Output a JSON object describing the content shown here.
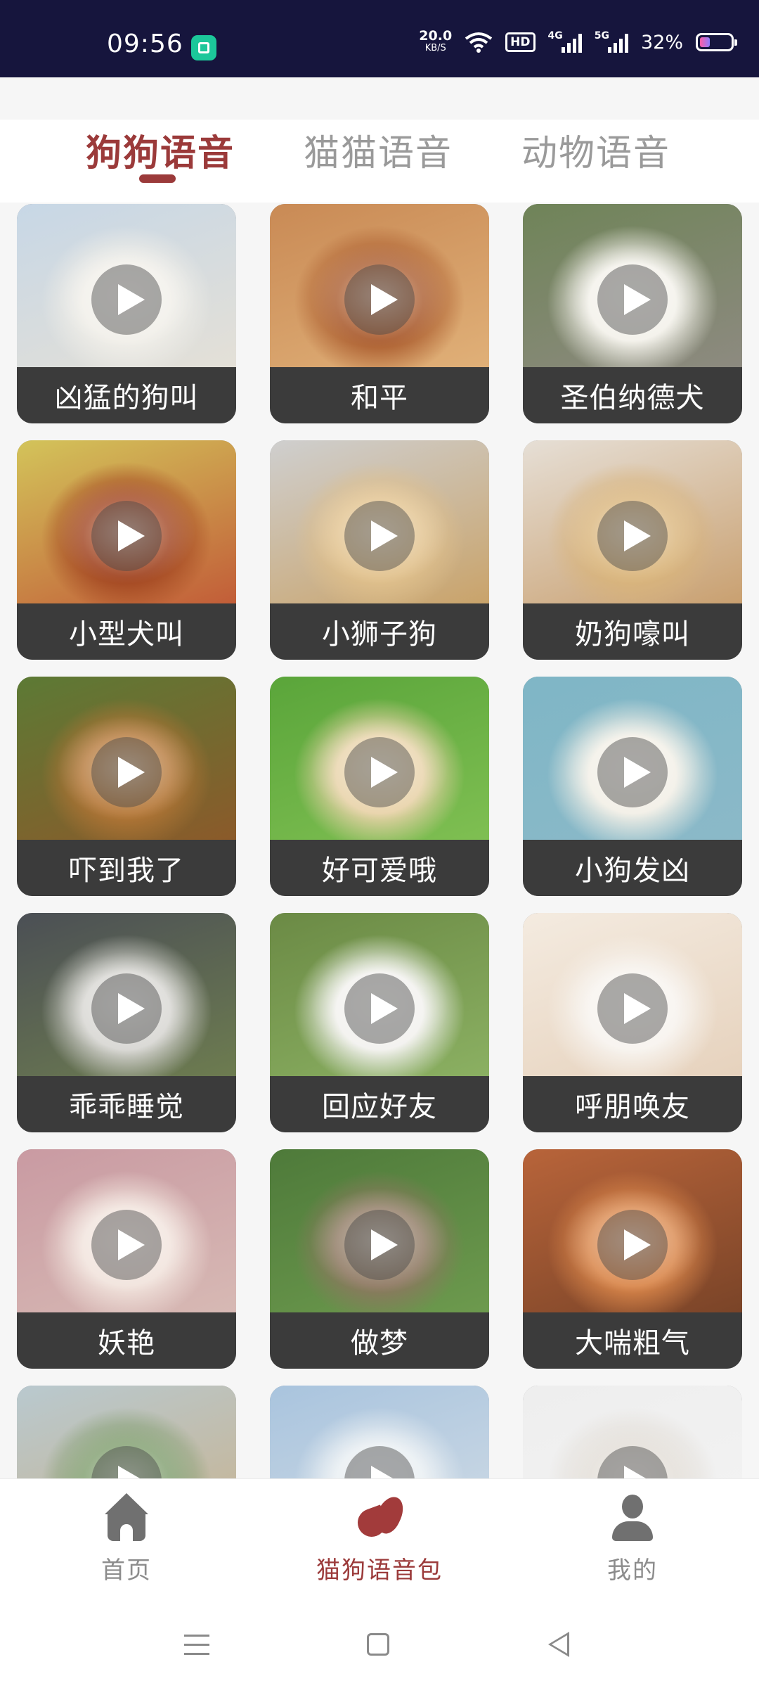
{
  "status_bar": {
    "time": "09:56",
    "net_speed": "20.0",
    "net_speed_unit": "KB/S",
    "hd_label": "HD",
    "network_1": "4G",
    "network_2": "5G",
    "battery": "32%",
    "battery_level": 0.32
  },
  "tabs": [
    {
      "label": "狗狗语音",
      "active": true
    },
    {
      "label": "猫猫语音",
      "active": false
    },
    {
      "label": "动物语音",
      "active": false
    }
  ],
  "cards": [
    {
      "label": "凶猛的狗叫",
      "colors": [
        "#c7d7e6",
        "#f1efe9",
        "#e4e0d7"
      ]
    },
    {
      "label": "和平",
      "colors": [
        "#c98a55",
        "#a95a2c",
        "#e0b078"
      ]
    },
    {
      "label": "圣伯纳德犬",
      "colors": [
        "#6f8458",
        "#f3f1ea",
        "#8d8a80"
      ]
    },
    {
      "label": "小型犬叫",
      "colors": [
        "#d3c45a",
        "#a0431f",
        "#c25d38"
      ]
    },
    {
      "label": "小狮子狗",
      "colors": [
        "#cfcfcf",
        "#e1c18c",
        "#c9a36a"
      ]
    },
    {
      "label": "奶狗嚎叫",
      "colors": [
        "#e6dfd6",
        "#d9b47a",
        "#c9a070"
      ]
    },
    {
      "label": "吓到我了",
      "colors": [
        "#5c7a35",
        "#b47636",
        "#8b5a2a"
      ]
    },
    {
      "label": "好可爱哦",
      "colors": [
        "#5aa53a",
        "#e8d2a8",
        "#7fbf52"
      ]
    },
    {
      "label": "小狗发凶",
      "colors": [
        "#7fb6c6",
        "#f2efe6",
        "#8bb9c8"
      ]
    },
    {
      "label": "乖乖睡觉",
      "colors": [
        "#4b4f55",
        "#d7d6d2",
        "#6d7c50"
      ]
    },
    {
      "label": "回应好友",
      "colors": [
        "#6b8a45",
        "#f2f1ee",
        "#8bb062"
      ]
    },
    {
      "label": "呼朋唤友",
      "colors": [
        "#f4ebe0",
        "#f7f3ee",
        "#e6d2bd"
      ]
    },
    {
      "label": "妖艳",
      "colors": [
        "#c99aa2",
        "#f1e3dc",
        "#d7b9b4"
      ]
    },
    {
      "label": "做梦",
      "colors": [
        "#4e7a3a",
        "#8d7760",
        "#6d9a4e"
      ]
    },
    {
      "label": "大喘粗气",
      "colors": [
        "#b8643a",
        "#d9864a",
        "#7a4428"
      ]
    },
    {
      "label": "",
      "colors": [
        "#b9c9cf",
        "#7c9b6a",
        "#c8b28e"
      ]
    },
    {
      "label": "",
      "colors": [
        "#a9c4de",
        "#e8eef2",
        "#d0dbe5"
      ]
    },
    {
      "label": "",
      "colors": [
        "#eeeeee",
        "#e2ddd6",
        "#f3f3f3"
      ]
    }
  ],
  "bottom_nav": {
    "home": "首页",
    "voice_pack": "猫狗语音包",
    "mine": "我的",
    "active": "voice_pack"
  },
  "colors": {
    "accent": "#9b3a3a",
    "status_bar_bg": "#16153d",
    "card_label_bg": "#3b3b3b"
  }
}
